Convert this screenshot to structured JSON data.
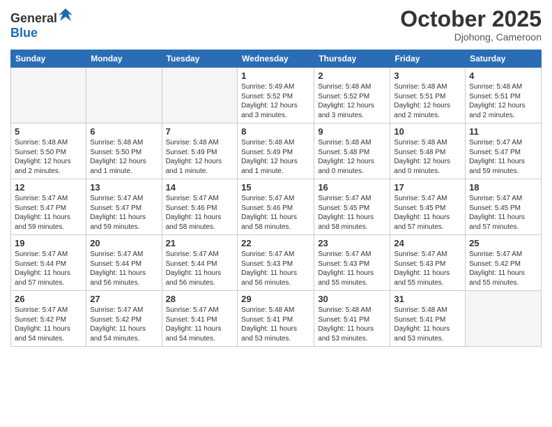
{
  "logo": {
    "line1": "General",
    "line2": "Blue"
  },
  "title": "October 2025",
  "subtitle": "Djohong, Cameroon",
  "days_of_week": [
    "Sunday",
    "Monday",
    "Tuesday",
    "Wednesday",
    "Thursday",
    "Friday",
    "Saturday"
  ],
  "weeks": [
    [
      {
        "day": "",
        "info": ""
      },
      {
        "day": "",
        "info": ""
      },
      {
        "day": "",
        "info": ""
      },
      {
        "day": "1",
        "info": "Sunrise: 5:49 AM\nSunset: 5:52 PM\nDaylight: 12 hours\nand 3 minutes."
      },
      {
        "day": "2",
        "info": "Sunrise: 5:48 AM\nSunset: 5:52 PM\nDaylight: 12 hours\nand 3 minutes."
      },
      {
        "day": "3",
        "info": "Sunrise: 5:48 AM\nSunset: 5:51 PM\nDaylight: 12 hours\nand 2 minutes."
      },
      {
        "day": "4",
        "info": "Sunrise: 5:48 AM\nSunset: 5:51 PM\nDaylight: 12 hours\nand 2 minutes."
      }
    ],
    [
      {
        "day": "5",
        "info": "Sunrise: 5:48 AM\nSunset: 5:50 PM\nDaylight: 12 hours\nand 2 minutes."
      },
      {
        "day": "6",
        "info": "Sunrise: 5:48 AM\nSunset: 5:50 PM\nDaylight: 12 hours\nand 1 minute."
      },
      {
        "day": "7",
        "info": "Sunrise: 5:48 AM\nSunset: 5:49 PM\nDaylight: 12 hours\nand 1 minute."
      },
      {
        "day": "8",
        "info": "Sunrise: 5:48 AM\nSunset: 5:49 PM\nDaylight: 12 hours\nand 1 minute."
      },
      {
        "day": "9",
        "info": "Sunrise: 5:48 AM\nSunset: 5:48 PM\nDaylight: 12 hours\nand 0 minutes."
      },
      {
        "day": "10",
        "info": "Sunrise: 5:48 AM\nSunset: 5:48 PM\nDaylight: 12 hours\nand 0 minutes."
      },
      {
        "day": "11",
        "info": "Sunrise: 5:47 AM\nSunset: 5:47 PM\nDaylight: 11 hours\nand 59 minutes."
      }
    ],
    [
      {
        "day": "12",
        "info": "Sunrise: 5:47 AM\nSunset: 5:47 PM\nDaylight: 11 hours\nand 59 minutes."
      },
      {
        "day": "13",
        "info": "Sunrise: 5:47 AM\nSunset: 5:47 PM\nDaylight: 11 hours\nand 59 minutes."
      },
      {
        "day": "14",
        "info": "Sunrise: 5:47 AM\nSunset: 5:46 PM\nDaylight: 11 hours\nand 58 minutes."
      },
      {
        "day": "15",
        "info": "Sunrise: 5:47 AM\nSunset: 5:46 PM\nDaylight: 11 hours\nand 58 minutes."
      },
      {
        "day": "16",
        "info": "Sunrise: 5:47 AM\nSunset: 5:45 PM\nDaylight: 11 hours\nand 58 minutes."
      },
      {
        "day": "17",
        "info": "Sunrise: 5:47 AM\nSunset: 5:45 PM\nDaylight: 11 hours\nand 57 minutes."
      },
      {
        "day": "18",
        "info": "Sunrise: 5:47 AM\nSunset: 5:45 PM\nDaylight: 11 hours\nand 57 minutes."
      }
    ],
    [
      {
        "day": "19",
        "info": "Sunrise: 5:47 AM\nSunset: 5:44 PM\nDaylight: 11 hours\nand 57 minutes."
      },
      {
        "day": "20",
        "info": "Sunrise: 5:47 AM\nSunset: 5:44 PM\nDaylight: 11 hours\nand 56 minutes."
      },
      {
        "day": "21",
        "info": "Sunrise: 5:47 AM\nSunset: 5:44 PM\nDaylight: 11 hours\nand 56 minutes."
      },
      {
        "day": "22",
        "info": "Sunrise: 5:47 AM\nSunset: 5:43 PM\nDaylight: 11 hours\nand 56 minutes."
      },
      {
        "day": "23",
        "info": "Sunrise: 5:47 AM\nSunset: 5:43 PM\nDaylight: 11 hours\nand 55 minutes."
      },
      {
        "day": "24",
        "info": "Sunrise: 5:47 AM\nSunset: 5:43 PM\nDaylight: 11 hours\nand 55 minutes."
      },
      {
        "day": "25",
        "info": "Sunrise: 5:47 AM\nSunset: 5:42 PM\nDaylight: 11 hours\nand 55 minutes."
      }
    ],
    [
      {
        "day": "26",
        "info": "Sunrise: 5:47 AM\nSunset: 5:42 PM\nDaylight: 11 hours\nand 54 minutes."
      },
      {
        "day": "27",
        "info": "Sunrise: 5:47 AM\nSunset: 5:42 PM\nDaylight: 11 hours\nand 54 minutes."
      },
      {
        "day": "28",
        "info": "Sunrise: 5:47 AM\nSunset: 5:41 PM\nDaylight: 11 hours\nand 54 minutes."
      },
      {
        "day": "29",
        "info": "Sunrise: 5:48 AM\nSunset: 5:41 PM\nDaylight: 11 hours\nand 53 minutes."
      },
      {
        "day": "30",
        "info": "Sunrise: 5:48 AM\nSunset: 5:41 PM\nDaylight: 11 hours\nand 53 minutes."
      },
      {
        "day": "31",
        "info": "Sunrise: 5:48 AM\nSunset: 5:41 PM\nDaylight: 11 hours\nand 53 minutes."
      },
      {
        "day": "",
        "info": ""
      }
    ]
  ]
}
